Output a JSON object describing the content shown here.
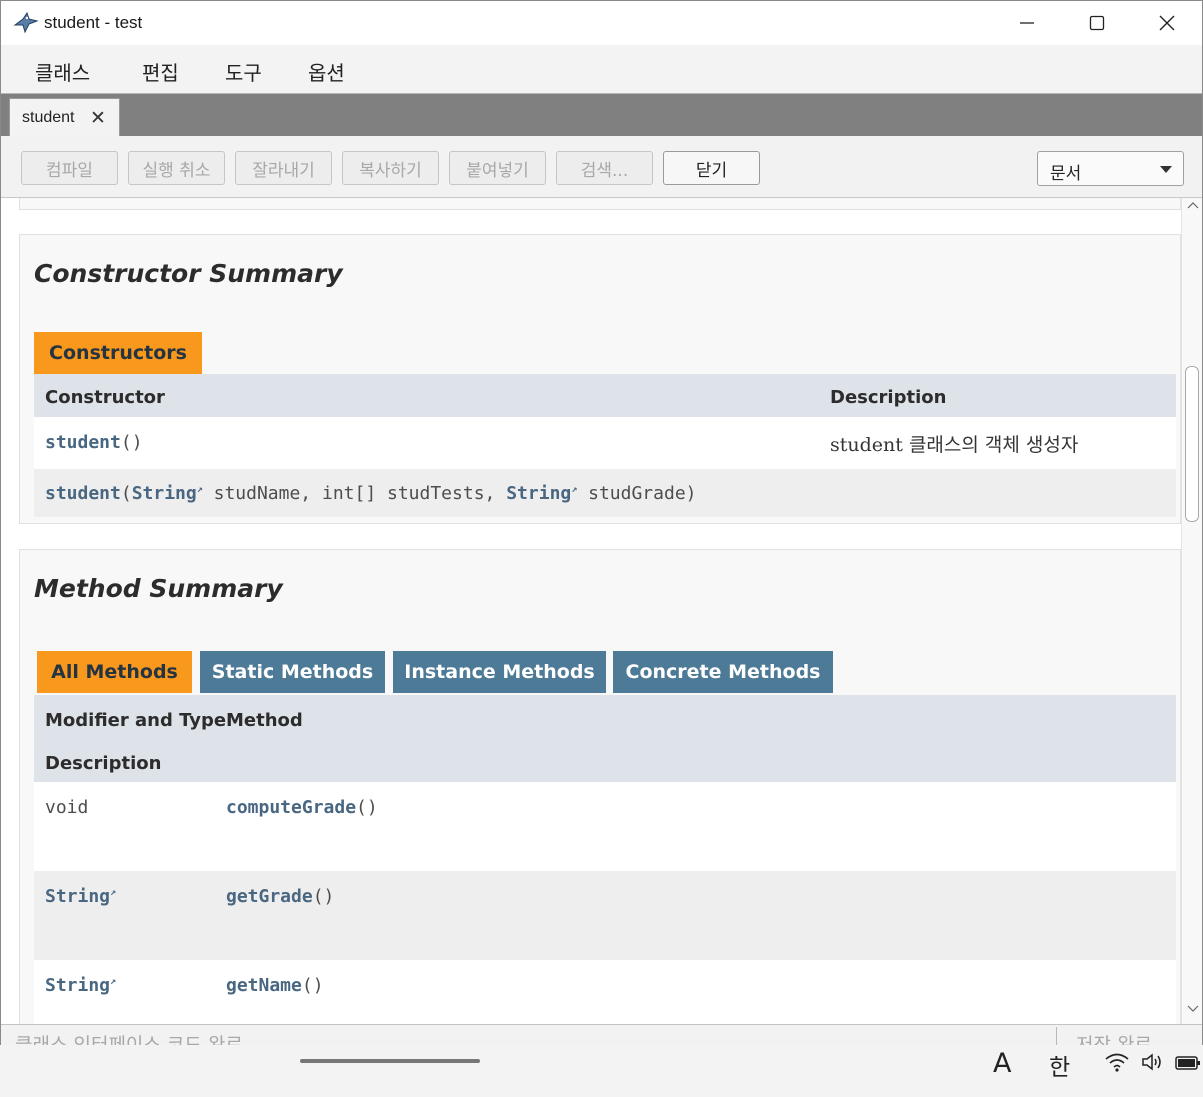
{
  "window": {
    "title": "student - test",
    "icons": {
      "app": "bluej-bird-icon",
      "minimize": "minimize-icon",
      "maximize": "maximize-icon",
      "close": "close-icon"
    }
  },
  "menu": [
    "클래스",
    "편집",
    "도구",
    "옵션"
  ],
  "tab": {
    "label": "student",
    "close": "✕"
  },
  "toolbar": {
    "buttons": [
      "컴파일",
      "실행 취소",
      "잘라내기",
      "복사하기",
      "붙여넣기",
      "검색...",
      "닫기"
    ],
    "view_select": "문서"
  },
  "constructor_summary": {
    "title": "Constructor Summary",
    "caption": "Constructors",
    "headers": {
      "constructor": "Constructor",
      "description": "Description"
    },
    "rows": [
      {
        "name": "student",
        "signature": "()",
        "description": "student 클래스의 객체 생성자"
      },
      {
        "name": "student",
        "open": "(",
        "type1": "String",
        "param1": "studName, int[] studTests, ",
        "type2": "String",
        "param2": "studGrade)",
        "description": ""
      }
    ]
  },
  "method_summary": {
    "title": "Method Summary",
    "tabs": [
      "All Methods",
      "Static Methods",
      "Instance Methods",
      "Concrete Methods"
    ],
    "active_tab": "All Methods",
    "headers": {
      "modifier": "Modifier and Type",
      "method": "Method",
      "description": "Description"
    },
    "rows": [
      {
        "type": "void",
        "type_is_link": false,
        "name": "computeGrade",
        "signature": "()"
      },
      {
        "type": "String",
        "type_is_link": true,
        "name": "getGrade",
        "signature": "()"
      },
      {
        "type": "String",
        "type_is_link": true,
        "name": "getName",
        "signature": "()"
      }
    ]
  },
  "status": {
    "left": "클래스 인터페이스 코드 완료",
    "right": "저장 완료"
  },
  "taskbar": {
    "ime_mode": "A",
    "ime_lang": "한",
    "tray": [
      "wifi-icon",
      "speaker-icon",
      "battery-icon"
    ]
  },
  "colors": {
    "accent_orange": "#f8981d",
    "tab_blue": "#4d7a97",
    "header_grey": "#dee3e9",
    "link": "#4a6782"
  }
}
